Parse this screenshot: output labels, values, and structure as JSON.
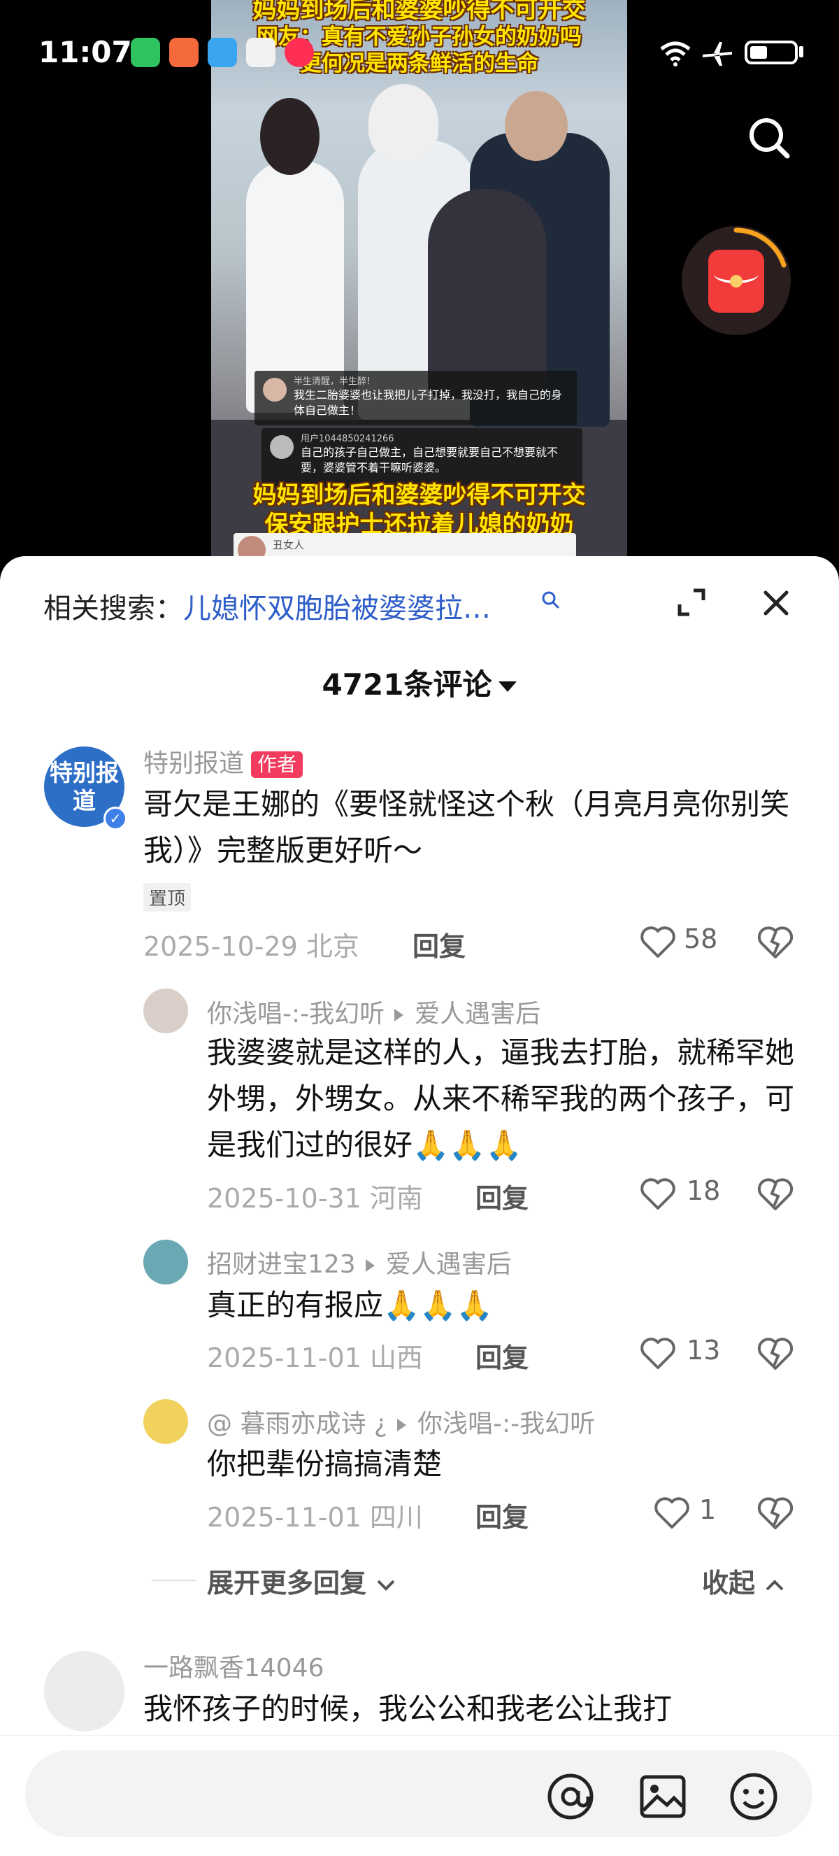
{
  "status_bar": {
    "time": "11:07"
  },
  "video": {
    "caption_top": "妈妈到场后和婆婆吵得不可开交",
    "caption_sub": "网友：真有不爱孙子孙女的奶奶吗",
    "caption_sub2": "更何况是两条鲜活的生命",
    "caption_bottom": "妈妈到场后和婆婆吵得不可开交",
    "caption_bottom2": "保安跟护士还拉着儿媳的奶奶",
    "overlay_comments": [
      {
        "name": "半生清醒，半生醉！",
        "text": "我生二胎婆婆也让我把儿子打掉，我没打，我自己的身体自己做主！"
      },
      {
        "name": "用户1044850241266",
        "text": "自己的孩子自己做主，自己想要就要自己不想要就不要，婆婆管不着干嘛听婆婆。"
      },
      {
        "name": "丑女人",
        "text": ""
      }
    ]
  },
  "sheet": {
    "related_label": "相关搜索：",
    "related_query": "儿媳怀双胞胎被婆婆拉…",
    "comment_count": "4721条评论",
    "expand_more": "展开更多回复",
    "collapse": "收起",
    "reply_label": "回复",
    "author_tag": "作者",
    "pinned_tag": "置顶"
  },
  "comments": [
    {
      "user": "特别报道",
      "avatar_text": "特别报道",
      "text": "哥欠是王娜的《要怪就怪这个秋（月亮月亮你别笑我）》完整版更好听～",
      "date_loc": "2025-10-29 北京",
      "likes": "58"
    },
    {
      "user": "你浅唱-:-我幻听",
      "reply_to": "爱人遇害后",
      "text": "我婆婆就是这样的人，逼我去打胎，就稀罕她外甥，外甥女。从来不稀罕我的两个孩子，可是我们过的很好🙏🙏🙏",
      "date_loc": "2025-10-31 河南",
      "likes": "18"
    },
    {
      "user": "招财进宝123",
      "reply_to": "爱人遇害后",
      "text": "真正的有报应🙏🙏🙏",
      "date_loc": "2025-11-01 山西",
      "likes": "13"
    },
    {
      "user": "@ 暮雨亦成诗 ¿",
      "reply_to": "你浅唱-:-我幻听",
      "text": "你把辈份搞搞清楚",
      "date_loc": "2025-11-01 四川",
      "likes": "1"
    },
    {
      "user": "一路飘香14046",
      "text": "我怀孩子的时候，我公公和我老公让我打"
    }
  ],
  "colors": {
    "accent_red": "#f23b5f",
    "link_blue": "#2d5dc9",
    "verified_blue": "#3f7fe8"
  },
  "icons": [
    "search-icon",
    "red-packet-icon",
    "expand-icon",
    "close-icon",
    "heart-icon",
    "dislike-icon",
    "at-icon",
    "image-icon",
    "emoji-icon"
  ]
}
